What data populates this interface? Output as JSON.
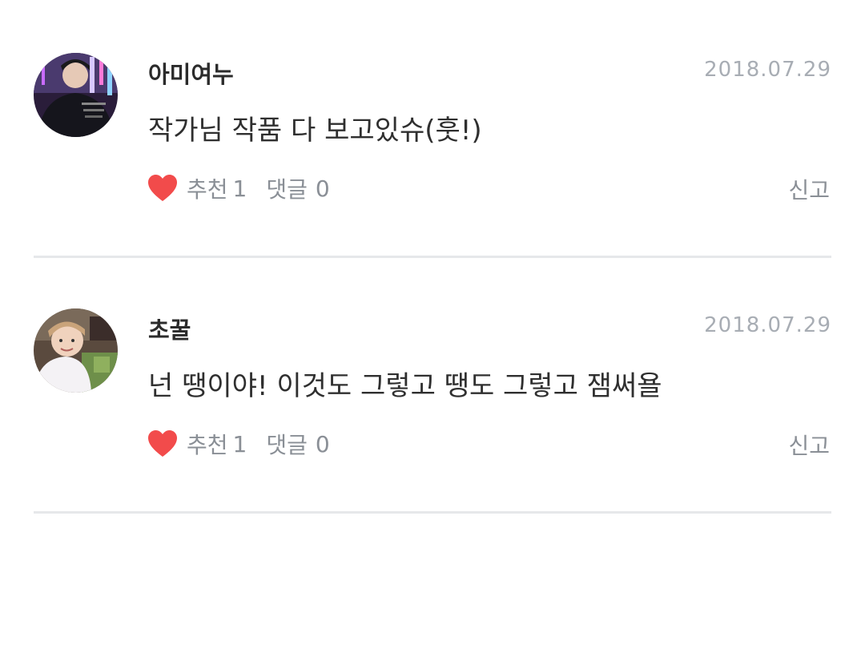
{
  "comments": [
    {
      "username": "아미여누",
      "date": "2018.07.29",
      "text": "작가님 작품 다 보고있슈(훗!)",
      "recommend_label": "추천",
      "recommend_count": "1",
      "reply_label": "댓글",
      "reply_count": "0",
      "report_label": "신고",
      "avatar_icon": "user-avatar-photo"
    },
    {
      "username": "초꿀",
      "date": "2018.07.29",
      "text": "넌 땡이야! 이것도 그렇고 땡도 그렇고 잼써욜",
      "recommend_label": "추천",
      "recommend_count": "1",
      "reply_label": "댓글",
      "reply_count": "0",
      "report_label": "신고",
      "avatar_icon": "user-avatar-photo"
    }
  ],
  "colors": {
    "heart": "#f24b4b",
    "date": "#a8adb4",
    "meta": "#8a8f96",
    "divider": "#e6e8ea",
    "text": "#2f2f2f"
  },
  "icons": {
    "recommend": "heart-icon"
  }
}
